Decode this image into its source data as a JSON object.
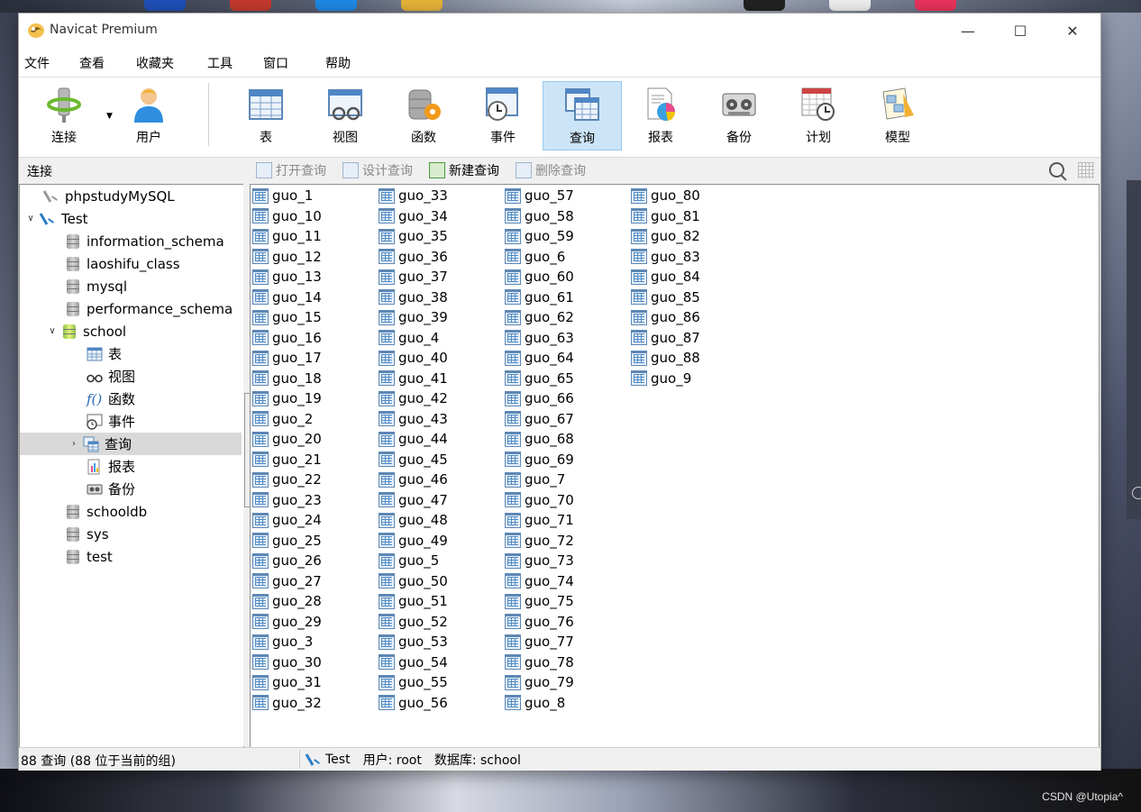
{
  "window": {
    "title": "Navicat Premium"
  },
  "menu": [
    "文件",
    "查看",
    "收藏夹",
    "工具",
    "窗口",
    "帮助"
  ],
  "toolbar": {
    "buttons": [
      {
        "label": "连接",
        "icon": "connection-plug-icon"
      },
      {
        "label": "用户",
        "icon": "user-icon"
      },
      {
        "label": "表",
        "icon": "table-icon"
      },
      {
        "label": "视图",
        "icon": "view-icon"
      },
      {
        "label": "函数",
        "icon": "function-icon"
      },
      {
        "label": "事件",
        "icon": "event-clock-icon"
      },
      {
        "label": "查询",
        "icon": "query-icon",
        "active": true
      },
      {
        "label": "报表",
        "icon": "report-icon"
      },
      {
        "label": "备份",
        "icon": "backup-icon"
      },
      {
        "label": "计划",
        "icon": "schedule-icon"
      },
      {
        "label": "模型",
        "icon": "model-icon"
      }
    ]
  },
  "subbar": {
    "section_label": "连接",
    "actions": [
      {
        "label": "打开查询",
        "enabled": false
      },
      {
        "label": "设计查询",
        "enabled": false
      },
      {
        "label": "新建查询",
        "enabled": true
      },
      {
        "label": "删除查询",
        "enabled": false
      }
    ]
  },
  "tree": {
    "items": [
      {
        "label": "phpstudyMySQL",
        "type": "connection",
        "state": "closed",
        "depth": 0
      },
      {
        "label": "Test",
        "type": "connection",
        "state": "open",
        "depth": 0,
        "expanded": true
      },
      {
        "label": "information_schema",
        "type": "database",
        "depth": 1
      },
      {
        "label": "laoshifu_class",
        "type": "database",
        "depth": 1
      },
      {
        "label": "mysql",
        "type": "database",
        "depth": 1
      },
      {
        "label": "performance_schema",
        "type": "database",
        "depth": 1
      },
      {
        "label": "school",
        "type": "database",
        "state": "open",
        "depth": 1,
        "expanded": true
      },
      {
        "label": "表",
        "type": "tables",
        "depth": 2
      },
      {
        "label": "视图",
        "type": "views",
        "depth": 2
      },
      {
        "label": "函数",
        "type": "functions",
        "depth": 2
      },
      {
        "label": "事件",
        "type": "events",
        "depth": 2
      },
      {
        "label": "查询",
        "type": "queries",
        "depth": 2,
        "selected": true,
        "collapsed_arrow": true
      },
      {
        "label": "报表",
        "type": "reports",
        "depth": 2
      },
      {
        "label": "备份",
        "type": "backups",
        "depth": 2
      },
      {
        "label": "schooldb",
        "type": "database",
        "depth": 1
      },
      {
        "label": "sys",
        "type": "database",
        "depth": 1
      },
      {
        "label": "test",
        "type": "database",
        "depth": 1
      }
    ]
  },
  "queries": {
    "columns": [
      [
        "guo_1",
        "guo_10",
        "guo_11",
        "guo_12",
        "guo_13",
        "guo_14",
        "guo_15",
        "guo_16",
        "guo_17",
        "guo_18",
        "guo_19",
        "guo_2",
        "guo_20",
        "guo_21",
        "guo_22",
        "guo_23",
        "guo_24",
        "guo_25",
        "guo_26",
        "guo_27",
        "guo_28",
        "guo_29",
        "guo_3",
        "guo_30",
        "guo_31",
        "guo_32"
      ],
      [
        "guo_33",
        "guo_34",
        "guo_35",
        "guo_36",
        "guo_37",
        "guo_38",
        "guo_39",
        "guo_4",
        "guo_40",
        "guo_41",
        "guo_42",
        "guo_43",
        "guo_44",
        "guo_45",
        "guo_46",
        "guo_47",
        "guo_48",
        "guo_49",
        "guo_5",
        "guo_50",
        "guo_51",
        "guo_52",
        "guo_53",
        "guo_54",
        "guo_55",
        "guo_56"
      ],
      [
        "guo_57",
        "guo_58",
        "guo_59",
        "guo_6",
        "guo_60",
        "guo_61",
        "guo_62",
        "guo_63",
        "guo_64",
        "guo_65",
        "guo_66",
        "guo_67",
        "guo_68",
        "guo_69",
        "guo_7",
        "guo_70",
        "guo_71",
        "guo_72",
        "guo_73",
        "guo_74",
        "guo_75",
        "guo_76",
        "guo_77",
        "guo_78",
        "guo_79",
        "guo_8"
      ],
      [
        "guo_80",
        "guo_81",
        "guo_82",
        "guo_83",
        "guo_84",
        "guo_85",
        "guo_86",
        "guo_87",
        "guo_88",
        "guo_9"
      ]
    ]
  },
  "status": {
    "left": "88 查询 (88 位于当前的组)",
    "connection": "Test",
    "user": "用户: root",
    "database": "数据库: school"
  },
  "watermark": "CSDN @Utopia^"
}
